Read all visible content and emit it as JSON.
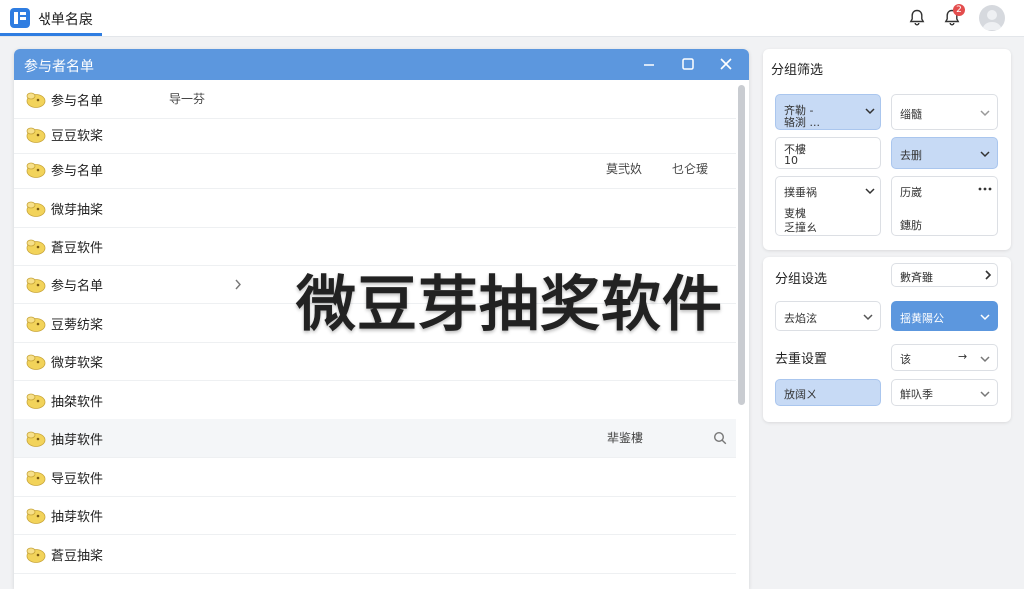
{
  "app": {
    "title": "샋单名扆"
  },
  "header": {
    "badge_count": "2"
  },
  "window": {
    "title": "参与者名单",
    "rows": [
      {
        "label": "参与名单",
        "extra": "导一芬"
      },
      {
        "label": "豆豆软桨"
      },
      {
        "label": "参与名单",
        "extra": "莫弐奺",
        "extra2": "乜仑瑷"
      },
      {
        "label": "微芽抽桨"
      },
      {
        "label": "蒼豆软件"
      },
      {
        "label": "参与名单"
      },
      {
        "label": "豆蒡纺桨"
      },
      {
        "label": "微芽软桨"
      },
      {
        "label": "抽桀软件"
      },
      {
        "label": "抽芽软件",
        "extra": "㹃鉴樓"
      },
      {
        "label": "导豆软件"
      },
      {
        "label": "抽芽软件"
      },
      {
        "label": "蒼豆抽桨"
      }
    ]
  },
  "overlay_text": "微豆芽抽奖软件",
  "filter": {
    "title": "分组筛选",
    "c1_line1": "齐勒 -",
    "c1_line2": "辂渕 ...",
    "c2": "缁髓",
    "c3_line1": "不樓",
    "c3_line2": "10",
    "c4": "去删",
    "c5_line1": "撲垂祸",
    "c5_line2": "叓槐",
    "c5_line3": "乏撞ㄠ",
    "c6_line1": "历崴",
    "c6_line2": "鏸肪"
  },
  "settings": {
    "title": "分组设选",
    "top_field": "數斉雖",
    "sel1": "去焰泫",
    "sel2": "揺黄陽公",
    "dedupe_label": "去重设置",
    "sel3": "该",
    "sel3_arrow": "→",
    "sel4": "放阔ㄨ",
    "sel5": "觧叺季"
  },
  "colors": {
    "accent": "#5c97de",
    "accent_light": "#c7daf5",
    "badge": "#e34d4d"
  }
}
